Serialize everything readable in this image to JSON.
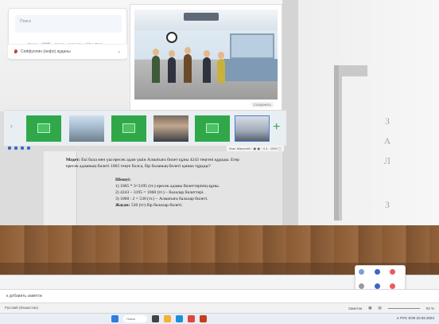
{
  "wall_letters": [
    "З",
    "А",
    "Л",
    "З"
  ],
  "top_card": {
    "search_placeholder": "Поиск",
    "options": [
      "Поиск",
      "Web",
      "Image",
      "Новости",
      "Video Фото"
    ],
    "location": "Сейфуллин (инфо) ауданы"
  },
  "panel": {
    "caption": "Сохранить"
  },
  "problem": {
    "intro_bold": "Мәдет:",
    "intro_text": "Екі бала мен үш ересек адам үшін Алматыға билет құны 4243 теңгені құрады. Егер ересек адамның билеті 1065 теңге болса, бір баланың билеті қанша тұрады?",
    "solution_head": "Шешуі:",
    "steps": [
      "1) 1065 * 3=3195 (тг.) ересек адамы билеттерінің құны.",
      "2) 4243 – 3195 = 1060 (тг.) – балалар билеттері.",
      "3) 1060 : 2 = 530 (тг.) – Алматыға балалар билеті."
    ],
    "answer_head": "Жауап:",
    "answer": "530 (тг) бір балалар билеті."
  },
  "strip": {
    "plus": "+",
    "arrow": "‹"
  },
  "status_right": "Изм. Масштаб ◦ ▣ ▣ ◦ 4 4 - 1000 ▢",
  "slide_note": "к добавить заметок",
  "status_bar": {
    "left": "Русский (Казахстан)",
    "notes": "Заметки",
    "zoom_pct": "93 %"
  },
  "taskbar": {
    "search": "Поиск",
    "tray": "∧ РУС  8:00  10.02.2024"
  },
  "colors": {
    "green_thumb": "#30a84a",
    "floor": "#8a5a34",
    "accent_blue": "#3b68c4"
  }
}
